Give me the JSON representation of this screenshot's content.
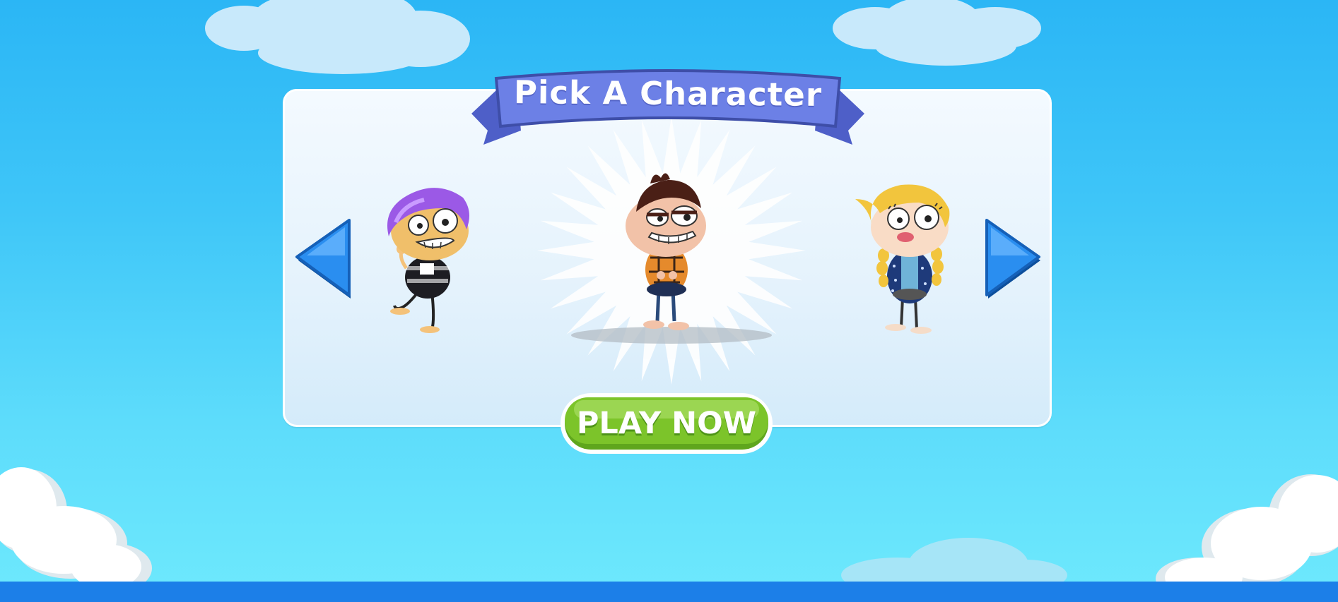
{
  "header": {
    "title": "Pick A Character"
  },
  "carousel": {
    "characters": [
      {
        "name": "purple-hair-boy",
        "hair_color": "#9b59e6"
      },
      {
        "name": "brown-hair-boy",
        "hair_color": "#4a1f16",
        "selected": true
      },
      {
        "name": "blonde-braids-girl",
        "hair_color": "#f2c53d"
      }
    ],
    "prev_icon": "left-arrow-icon",
    "next_icon": "right-arrow-icon"
  },
  "play_button": {
    "label": "PLAY NOW",
    "color": "#7cc42a"
  },
  "colors": {
    "sky": "#2bb6f5",
    "ribbon": "#5b6fd6",
    "arrow": "#1e7fe0",
    "bottom_bar": "#1c7fe8"
  }
}
